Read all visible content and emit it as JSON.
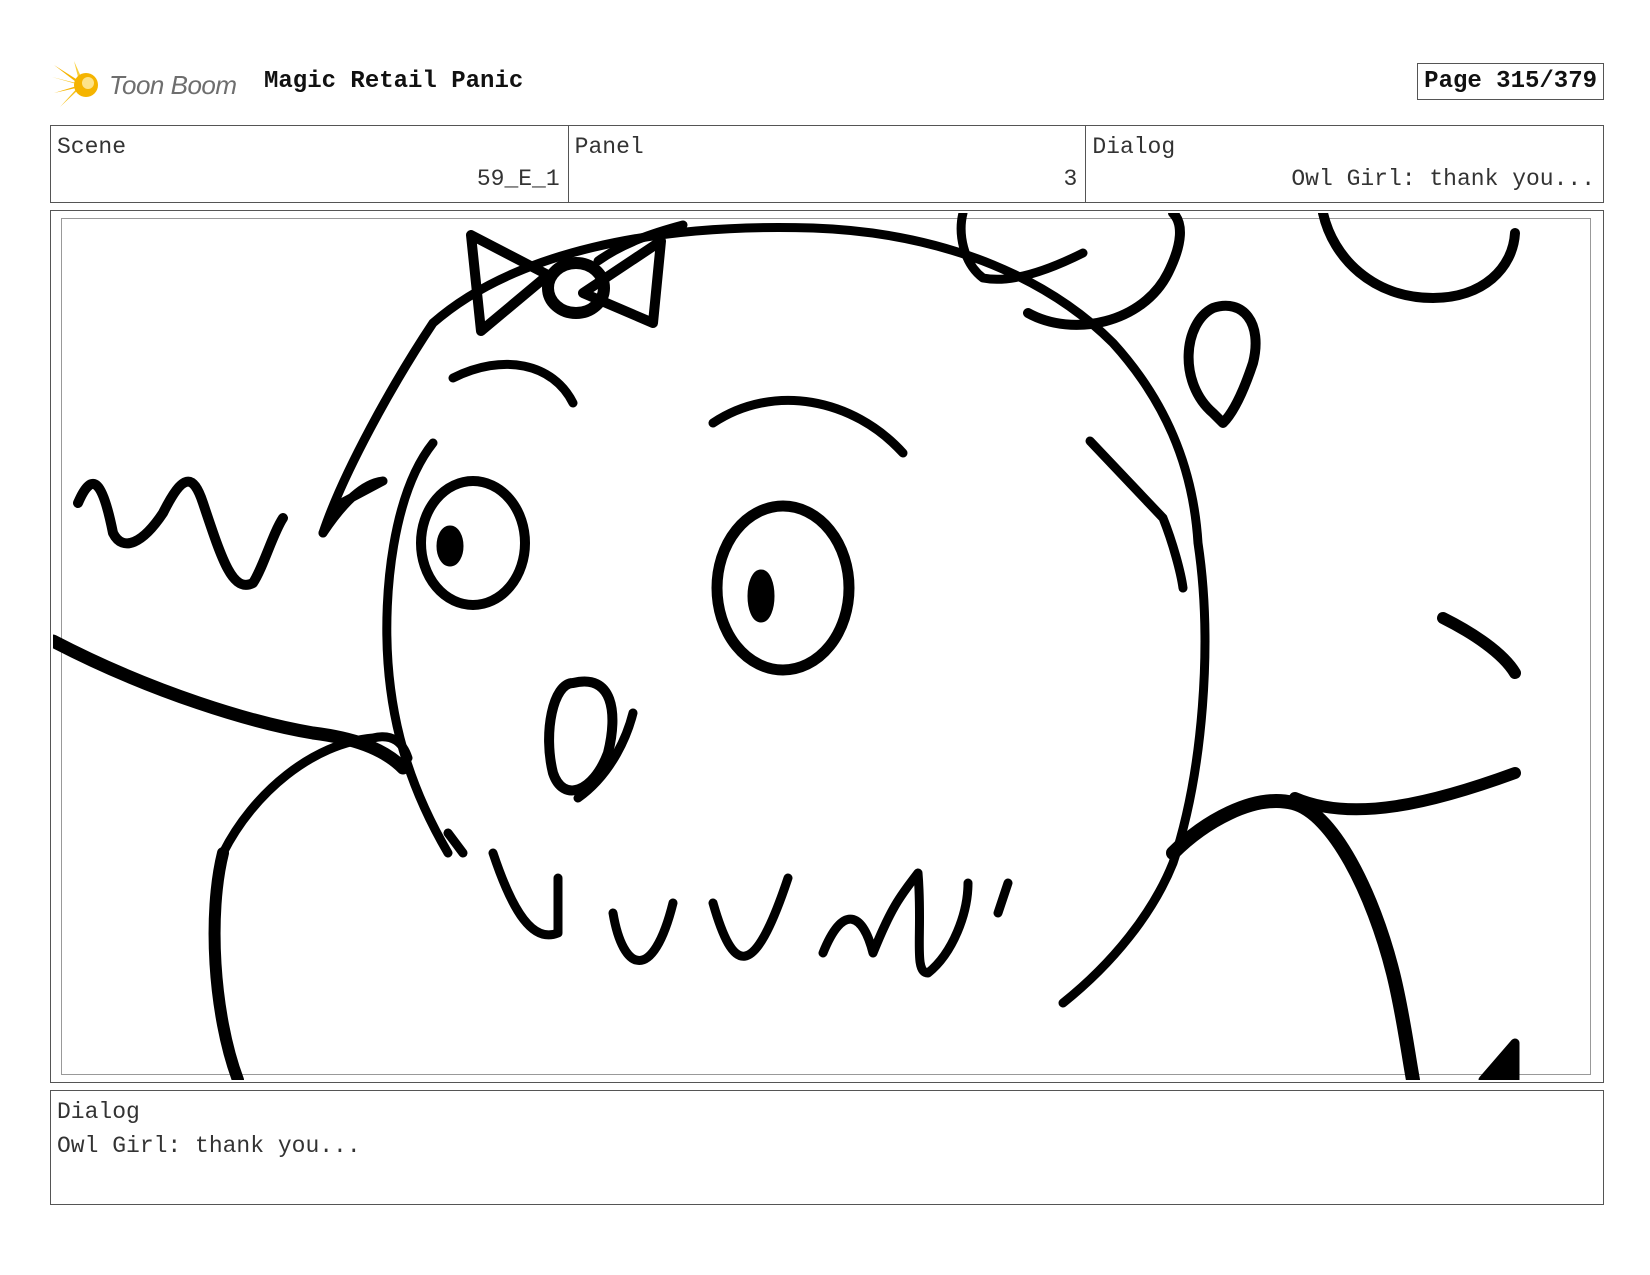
{
  "header": {
    "logo_text": "Toon Boom",
    "project_title": "Magic Retail Panic",
    "page_label": "Page 315/379"
  },
  "info": {
    "scene_label": "Scene",
    "scene_value": "59_E_1",
    "panel_label": "Panel",
    "panel_value": "3",
    "dialog_label": "Dialog",
    "dialog_value": "Owl Girl: thank you..."
  },
  "dialog_box": {
    "label": "Dialog",
    "text": "Owl Girl: thank you..."
  },
  "colors": {
    "logo_accent": "#f5b400",
    "line": "#000000"
  },
  "icons": {
    "logo": "toon-boom-starburst-icon"
  }
}
